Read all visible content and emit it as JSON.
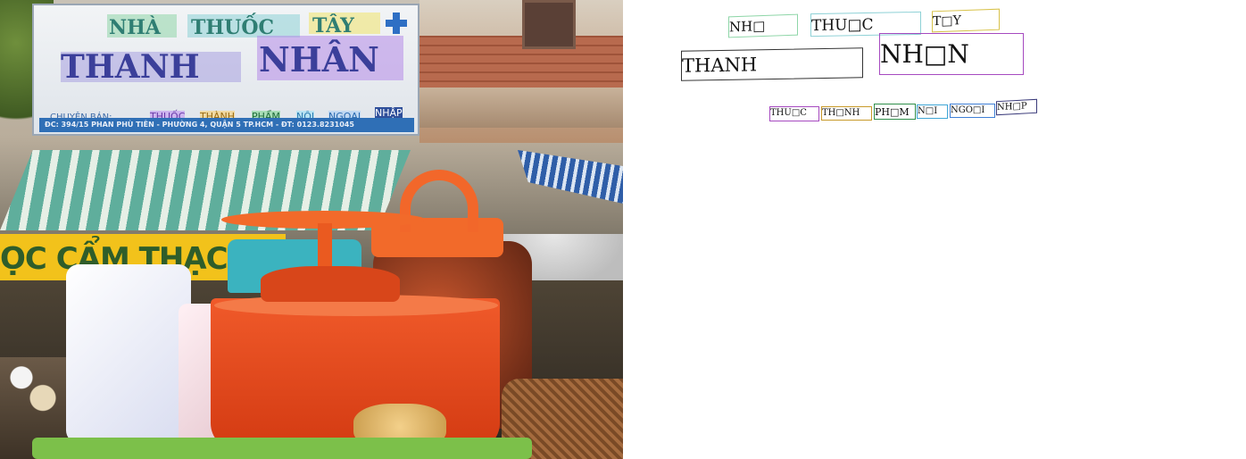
{
  "photo": {
    "sign": {
      "line1": [
        "NHÀ",
        "THUỐC",
        "TÂY"
      ],
      "line2": [
        "THANH",
        "NHÂN"
      ],
      "services_prefix": "CHUYÊN BÁN:",
      "services": [
        "THUỐC",
        "THÀNH",
        "PHẨM",
        "NỘI",
        "NGOẠI",
        "NHẬP"
      ],
      "address": "ĐC: 394/15 PHAN PHÙ TIÊN - PHƯỜNG 4, QUẬN 5 TP.HCM - ĐT: 0123.8231045"
    },
    "banner": "ỌC CẨM THẠCH"
  },
  "annotations": {
    "row1": [
      {
        "text": "NH□",
        "color": "#8fd6a8"
      },
      {
        "text": "THU□C",
        "color": "#8ed1d6"
      },
      {
        "text": "T□Y",
        "color": "#d8c24a"
      }
    ],
    "row2": [
      {
        "text": "THANH",
        "color": "#333333"
      },
      {
        "text": "NH□N",
        "color": "#a64ac0"
      }
    ],
    "row3": [
      {
        "text": "THU□C",
        "color": "#a64ac0"
      },
      {
        "text": "TH□NH",
        "color": "#c89a2a"
      },
      {
        "text": "PH□M",
        "color": "#2f8f4a"
      },
      {
        "text": "N□I",
        "color": "#3fa6d6"
      },
      {
        "text": "NGO□I",
        "color": "#3f7fd6"
      },
      {
        "text": "NH□P",
        "color": "#3a3a7a"
      }
    ]
  }
}
